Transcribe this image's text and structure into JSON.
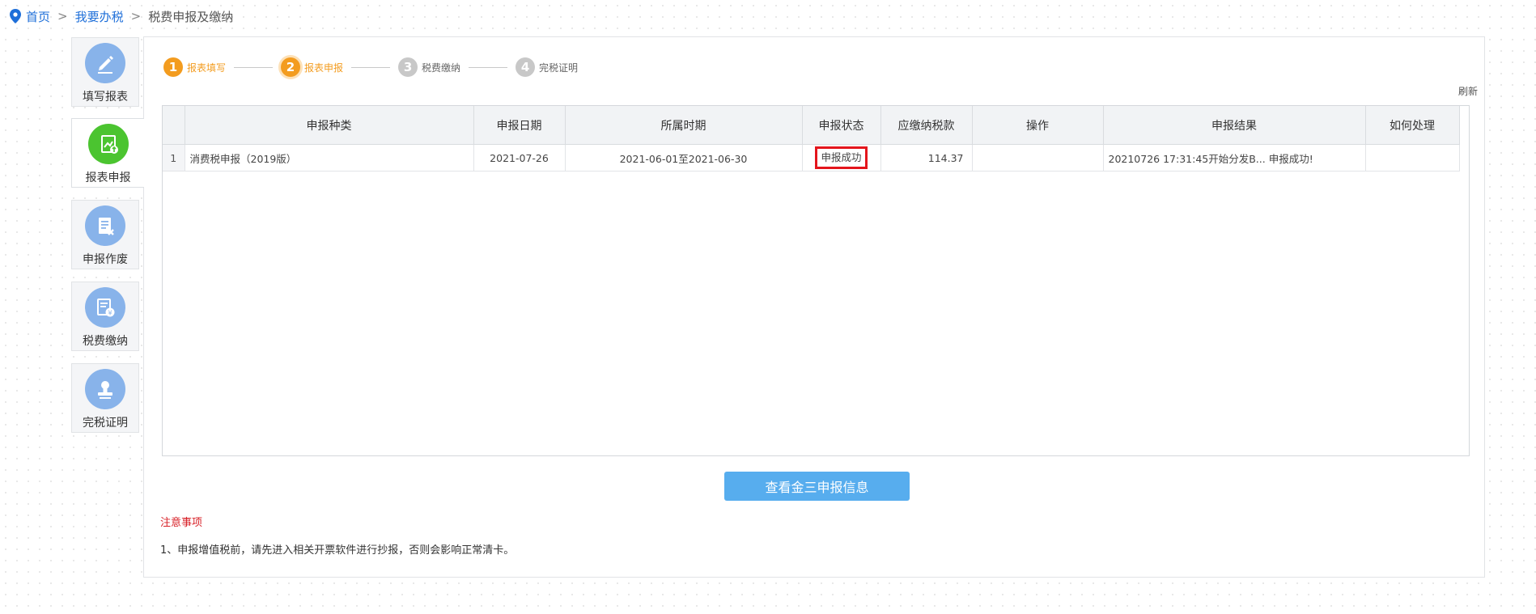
{
  "breadcrumb": {
    "icon": "location-pin-icon",
    "home": "首页",
    "section": "我要办税",
    "current": "税费申报及缴纳",
    "separator": ">"
  },
  "sidebar": {
    "items": [
      {
        "label": "填写报表",
        "icon": "pencil-icon",
        "active": false
      },
      {
        "label": "报表申报",
        "icon": "report-upload-icon",
        "active": true
      },
      {
        "label": "申报作废",
        "icon": "document-cancel-icon",
        "active": false
      },
      {
        "label": "税费缴纳",
        "icon": "tax-payment-icon",
        "active": false
      },
      {
        "label": "完税证明",
        "icon": "certificate-stamp-icon",
        "active": false
      }
    ]
  },
  "steps": [
    {
      "num": "1",
      "label": "报表填写",
      "state": "done"
    },
    {
      "num": "2",
      "label": "报表申报",
      "state": "current"
    },
    {
      "num": "3",
      "label": "税费缴纳",
      "state": "todo"
    },
    {
      "num": "4",
      "label": "完税证明",
      "state": "todo"
    }
  ],
  "refresh_label": "刷新",
  "table": {
    "headers": [
      "",
      "申报种类",
      "申报日期",
      "所属时期",
      "申报状态",
      "应缴纳税款",
      "操作",
      "申报结果",
      "如何处理"
    ],
    "rows": [
      {
        "index": "1",
        "type": "消费税申报（2019版）",
        "date": "2021-07-26",
        "period": "2021-06-01至2021-06-30",
        "status": "申报成功",
        "amount": "114.37",
        "operation": "",
        "result": "20210726 17:31:45开始分发B... 申报成功!",
        "handling": ""
      }
    ]
  },
  "query_button": "查看金三申报信息",
  "notice": {
    "title": "注意事项",
    "text": "1、申报增值税前，请先进入相关开票软件进行抄报，否则会影响正常清卡。"
  },
  "colors": {
    "link": "#1e6fd9",
    "step_active": "#f39c1f",
    "step_inactive": "#c8c8c8",
    "nav_icon": "#88b3ea",
    "nav_icon_active": "#4bc430",
    "button": "#57adee",
    "highlight_border": "#e4151c",
    "notice_title": "#d71f26"
  }
}
